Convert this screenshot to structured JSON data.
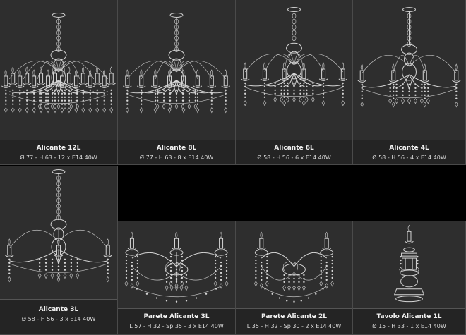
{
  "products": [
    {
      "name": "Alicante 12L",
      "spec": "Ø 77 - H 63 - 12 x E14 40W",
      "icon": "chandelier-12-lights-icon"
    },
    {
      "name": "Alicante 8L",
      "spec": "Ø 77 - H 63 - 8 x E14 40W",
      "icon": "chandelier-8-lights-icon"
    },
    {
      "name": "Alicante 6L",
      "spec": "Ø 58 - H 56 - 6 x E14 40W",
      "icon": "chandelier-6-lights-icon"
    },
    {
      "name": "Alicante 4L",
      "spec": "Ø 58 - H 56 - 4 x E14 40W",
      "icon": "chandelier-4-lights-icon"
    },
    {
      "name": "Alicante 3L",
      "spec": "Ø 58 - H 56 - 3 x E14 40W",
      "icon": "chandelier-3-lights-icon"
    },
    {
      "name": "Parete Alicante 3L",
      "spec": "L 57 - H 32 - Sp 35 - 3 x E14 40W",
      "icon": "wall-lamp-3-lights-icon"
    },
    {
      "name": "Parete Alicante 2L",
      "spec": "L 35 - H 32 - Sp 30 - 2 x E14 40W",
      "icon": "wall-lamp-2-lights-icon"
    },
    {
      "name": "Tavolo Alicante 1L",
      "spec": "Ø 15 - H 33 - 1 x E14 40W",
      "icon": "table-lamp-1-light-icon"
    }
  ]
}
